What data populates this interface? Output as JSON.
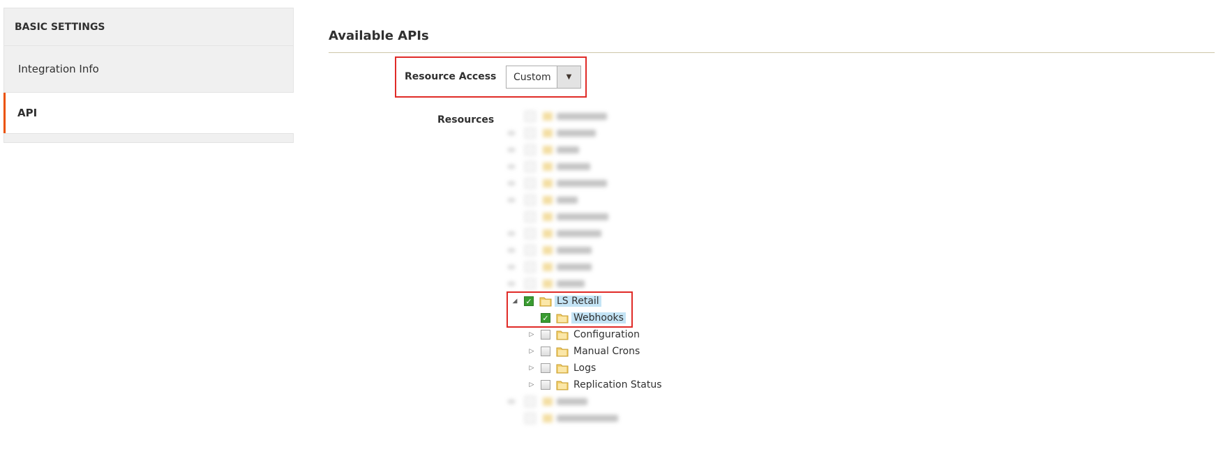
{
  "sidebar": {
    "heading": "BASIC SETTINGS",
    "items": [
      {
        "label": "Integration Info"
      },
      {
        "label": "API"
      }
    ]
  },
  "main": {
    "section_title": "Available APIs",
    "resource_access": {
      "label": "Resource Access",
      "value": "Custom"
    },
    "resources": {
      "label": "Resources",
      "tree": [
        {
          "label": "LS Retail",
          "checked": true,
          "expanded": true
        },
        {
          "label": "Webhooks",
          "checked": true
        },
        {
          "label": "Configuration",
          "checked": false
        },
        {
          "label": "Manual Crons",
          "checked": false
        },
        {
          "label": "Logs",
          "checked": false
        },
        {
          "label": "Replication Status",
          "checked": false
        }
      ]
    }
  },
  "colors": {
    "accent": "#eb5202",
    "highlight_border": "#e02b27",
    "selection": "#c4e4f5",
    "check_green": "#3a9c31"
  }
}
